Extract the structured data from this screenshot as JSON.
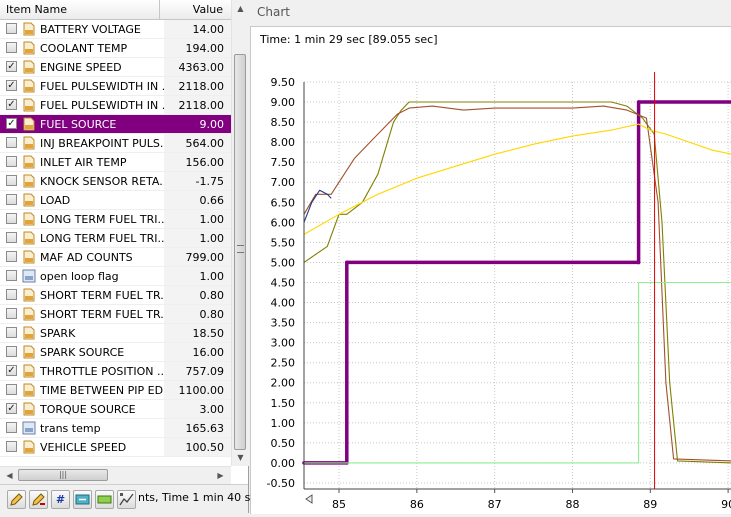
{
  "table": {
    "col_name": "Item Name",
    "col_value": "Value",
    "rows": [
      {
        "name": "BATTERY VOLTAGE",
        "value": "14.00",
        "checked": false,
        "icon": "pid"
      },
      {
        "name": "COOLANT TEMP",
        "value": "194.00",
        "checked": false,
        "icon": "pid"
      },
      {
        "name": "ENGINE SPEED",
        "value": "4363.00",
        "checked": true,
        "icon": "pid"
      },
      {
        "name": "FUEL PULSEWIDTH IN ...",
        "value": "2118.00",
        "checked": true,
        "icon": "pid"
      },
      {
        "name": "FUEL PULSEWIDTH IN ...",
        "value": "2118.00",
        "checked": true,
        "icon": "pid"
      },
      {
        "name": "FUEL SOURCE",
        "value": "9.00",
        "checked": true,
        "icon": "pid",
        "selected": true
      },
      {
        "name": "INJ BREAKPOINT PULS...",
        "value": "564.00",
        "checked": false,
        "icon": "pid"
      },
      {
        "name": "INLET AIR TEMP",
        "value": "156.00",
        "checked": false,
        "icon": "pid"
      },
      {
        "name": "KNOCK SENSOR RETA...",
        "value": "-1.75",
        "checked": false,
        "icon": "pid"
      },
      {
        "name": "LOAD",
        "value": "0.66",
        "checked": false,
        "icon": "pid"
      },
      {
        "name": "LONG TERM FUEL TRI...",
        "value": "1.00",
        "checked": false,
        "icon": "pid"
      },
      {
        "name": "LONG TERM FUEL TRI...",
        "value": "1.00",
        "checked": false,
        "icon": "pid"
      },
      {
        "name": "MAF AD COUNTS",
        "value": "799.00",
        "checked": false,
        "icon": "pid"
      },
      {
        "name": "open loop flag",
        "value": "1.00",
        "checked": false,
        "icon": "calc"
      },
      {
        "name": "SHORT TERM FUEL TR...",
        "value": "0.80",
        "checked": false,
        "icon": "pid"
      },
      {
        "name": "SHORT TERM FUEL TR...",
        "value": "0.80",
        "checked": false,
        "icon": "pid"
      },
      {
        "name": "SPARK",
        "value": "18.50",
        "checked": false,
        "icon": "pid"
      },
      {
        "name": "SPARK SOURCE",
        "value": "16.00",
        "checked": false,
        "icon": "pid"
      },
      {
        "name": "THROTTLE POSITION ...",
        "value": "757.09",
        "checked": true,
        "icon": "pid"
      },
      {
        "name": "TIME BETWEEN PIP ED...",
        "value": "1100.00",
        "checked": false,
        "icon": "pid"
      },
      {
        "name": "TORQUE SOURCE",
        "value": "3.00",
        "checked": true,
        "icon": "pid"
      },
      {
        "name": "trans temp",
        "value": "165.63",
        "checked": false,
        "icon": "calc"
      },
      {
        "name": "VEHICLE SPEED",
        "value": "100.50",
        "checked": false,
        "icon": "pid"
      }
    ]
  },
  "toolbar": {
    "buttons": [
      "pencil-icon",
      "pencil-edit-icon",
      "hash-icon",
      "fit-icon",
      "minimize-icon",
      "measure-icon"
    ],
    "hash_glyph": "#",
    "status_text": "nts, Time 1 min 40 sec"
  },
  "chart": {
    "panel_title": "Chart",
    "time_label": "Time: 1 min 29 sec [89.055 sec]"
  },
  "chart_data": {
    "type": "line",
    "title": "",
    "xlabel": "",
    "ylabel": "",
    "xlim": [
      84.55,
      90.05
    ],
    "ylim": [
      -0.65,
      9.5
    ],
    "x_ticks": [
      85,
      86,
      87,
      88,
      89,
      90
    ],
    "x_tick_labels": [
      "85",
      "86",
      "87",
      "88",
      "89",
      "90"
    ],
    "y_ticks": [
      -0.5,
      0,
      0.5,
      1,
      1.5,
      2,
      2.5,
      3,
      3.5,
      4,
      4.5,
      5,
      5.5,
      6,
      6.5,
      7,
      7.5,
      8,
      8.5,
      9,
      9.5
    ],
    "y_tick_labels": [
      "-0.50",
      "0.00",
      "0.50",
      "1.00",
      "1.50",
      "2.00",
      "2.50",
      "3.00",
      "3.50",
      "4.00",
      "4.50",
      "5.00",
      "5.50",
      "6.00",
      "6.50",
      "7.00",
      "7.50",
      "8.00",
      "8.50",
      "9.00",
      "9.50"
    ],
    "grid": true,
    "cursor_x": 89.055,
    "series": [
      {
        "color": "#800080",
        "points": [
          [
            84.55,
            0.0
          ],
          [
            85.1,
            0.0
          ],
          [
            85.1,
            5.0
          ],
          [
            88.85,
            5.0
          ],
          [
            88.85,
            9.0
          ],
          [
            90.05,
            9.0
          ]
        ]
      },
      {
        "color": "#808000",
        "points": [
          [
            84.55,
            5.0
          ],
          [
            84.85,
            5.4
          ],
          [
            85.0,
            6.2
          ],
          [
            85.1,
            6.2
          ],
          [
            85.3,
            6.5
          ],
          [
            85.5,
            7.2
          ],
          [
            85.7,
            8.5
          ],
          [
            85.8,
            8.8
          ],
          [
            85.9,
            9.0
          ],
          [
            88.5,
            9.0
          ],
          [
            88.7,
            8.9
          ],
          [
            88.9,
            8.6
          ],
          [
            89.05,
            8.2
          ],
          [
            89.15,
            6.0
          ],
          [
            89.25,
            2.0
          ],
          [
            89.35,
            0.05
          ],
          [
            90.05,
            0.0
          ]
        ]
      },
      {
        "color": "#a0522d",
        "points": [
          [
            84.55,
            6.2
          ],
          [
            84.7,
            6.7
          ],
          [
            84.9,
            6.7
          ],
          [
            85.0,
            7.0
          ],
          [
            85.2,
            7.6
          ],
          [
            85.4,
            8.0
          ],
          [
            85.6,
            8.4
          ],
          [
            85.75,
            8.7
          ],
          [
            85.9,
            8.85
          ],
          [
            86.2,
            8.9
          ],
          [
            86.6,
            8.8
          ],
          [
            87.0,
            8.85
          ],
          [
            87.5,
            8.85
          ],
          [
            88.0,
            8.85
          ],
          [
            88.4,
            8.9
          ],
          [
            88.7,
            8.8
          ],
          [
            88.95,
            8.6
          ],
          [
            89.1,
            6.5
          ],
          [
            89.2,
            2.0
          ],
          [
            89.3,
            0.1
          ],
          [
            90.05,
            0.05
          ]
        ]
      },
      {
        "color": "#1f3a8a",
        "points": [
          [
            84.55,
            6.0
          ],
          [
            84.65,
            6.5
          ],
          [
            84.75,
            6.8
          ],
          [
            84.85,
            6.7
          ],
          [
            84.9,
            6.6
          ]
        ]
      },
      {
        "color": "#ffd700",
        "points": [
          [
            84.55,
            5.7
          ],
          [
            85.0,
            6.2
          ],
          [
            85.5,
            6.7
          ],
          [
            86.0,
            7.1
          ],
          [
            86.5,
            7.4
          ],
          [
            87.0,
            7.7
          ],
          [
            87.5,
            7.95
          ],
          [
            88.0,
            8.15
          ],
          [
            88.5,
            8.3
          ],
          [
            88.85,
            8.45
          ],
          [
            89.0,
            8.3
          ],
          [
            89.2,
            8.2
          ],
          [
            89.5,
            8.0
          ],
          [
            89.8,
            7.8
          ],
          [
            90.05,
            7.7
          ]
        ]
      },
      {
        "color": "#90ee90",
        "points": [
          [
            84.55,
            0.0
          ],
          [
            88.85,
            0.0
          ],
          [
            88.85,
            4.5
          ],
          [
            90.05,
            4.5
          ]
        ]
      }
    ]
  }
}
